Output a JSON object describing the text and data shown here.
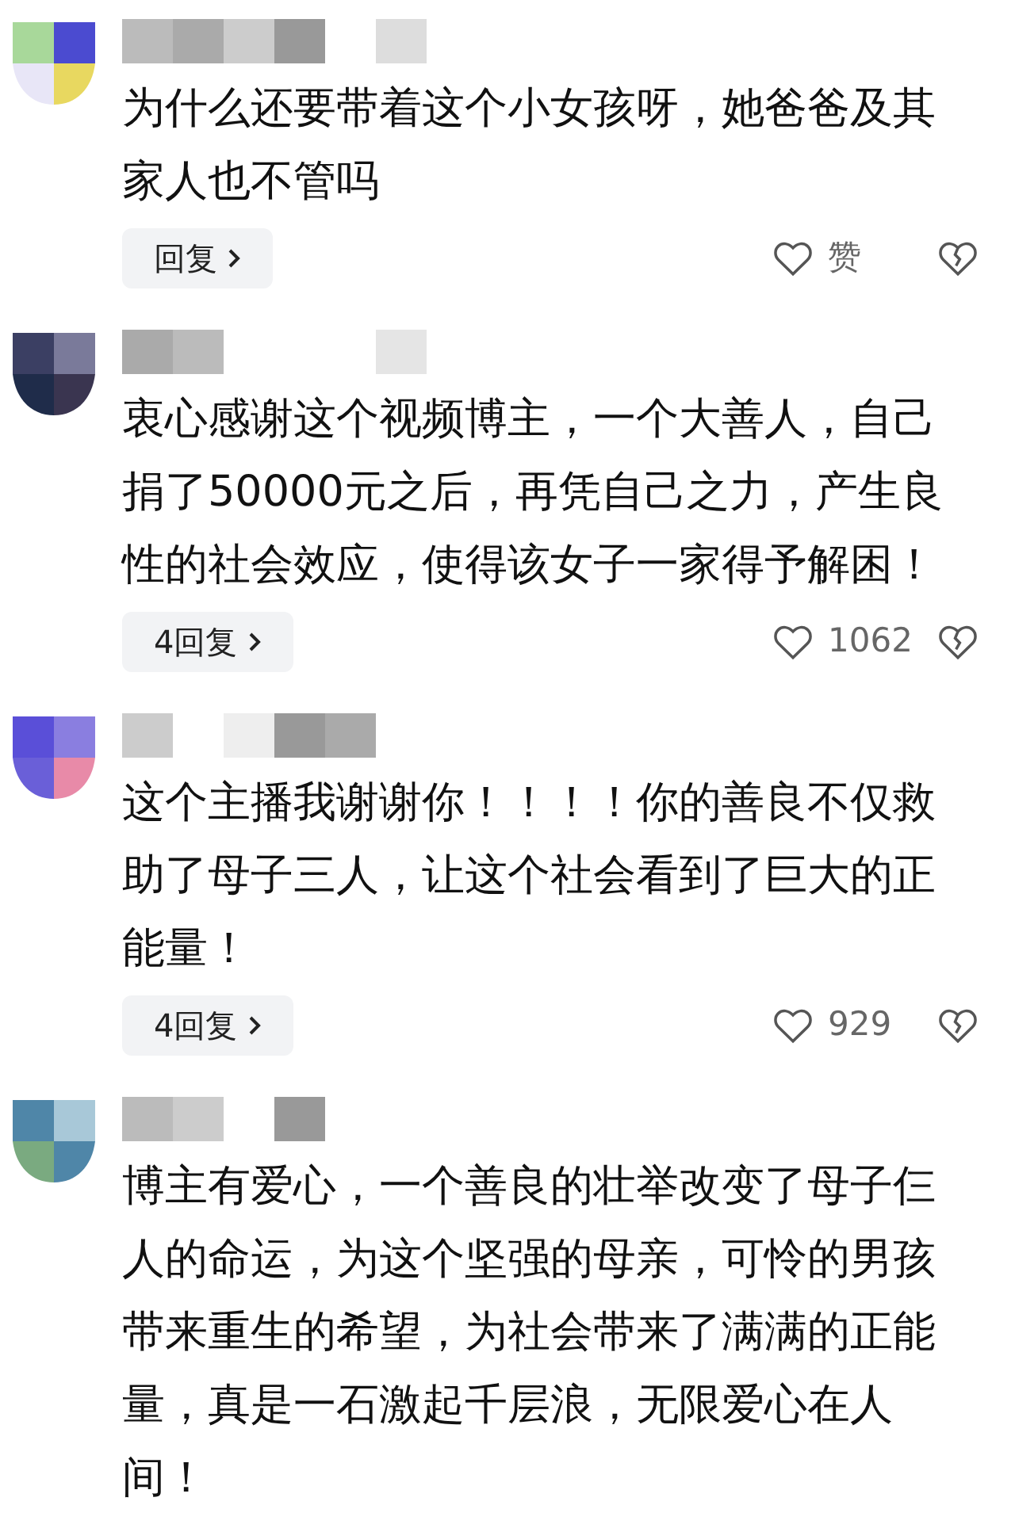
{
  "comments": [
    {
      "text": "为什么还要带着这个小女孩呀，她爸爸及其家人也不管吗",
      "reply_label": "回复",
      "likes": "赞"
    },
    {
      "text": "衷心感谢这个视频博主，一个大善人，自己捐了50000元之后，再凭自己之力，产生良性的社会效应，使得该女子一家得予解困！",
      "reply_label": "4回复",
      "likes": "1062"
    },
    {
      "text": "这个主播我谢谢你！！！！你的善良不仅救助了母子三人，让这个社会看到了巨大的正能量！",
      "reply_label": "4回复",
      "likes": "929"
    },
    {
      "text": "博主有爱心，一个善良的壮举改变了母子仨人的命运，为这个坚强的母亲，可怜的男孩带来重生的希望，为社会带来了满满的正能量，真是一石激起千层浪，无限爱心在人间！"
    }
  ]
}
